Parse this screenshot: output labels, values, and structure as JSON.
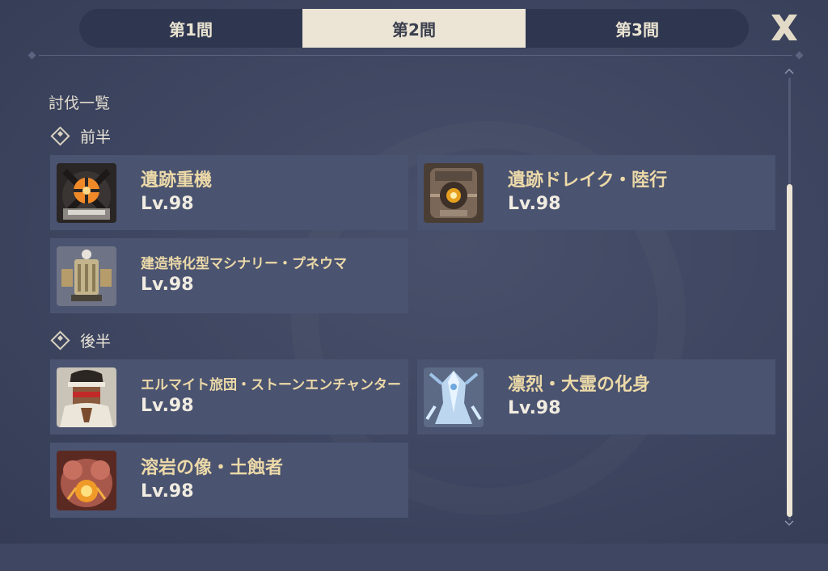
{
  "tabs": [
    {
      "label": "第1間",
      "active": false
    },
    {
      "label": "第2間",
      "active": true
    },
    {
      "label": "第3間",
      "active": false
    }
  ],
  "close_icon": "close-x-icon",
  "list_title": "討伐一覧",
  "sections": [
    {
      "label": "前半",
      "enemies": [
        {
          "name": "遺跡重機",
          "level": "Lv.98",
          "icon": "ruin-grader-icon"
        },
        {
          "name": "遺跡ドレイク・陸行",
          "level": "Lv.98",
          "icon": "ruin-drake-earthguard-icon"
        },
        {
          "name": "建造特化型マシナリー・プネウマ",
          "level": "Lv.98",
          "icon": "construction-machinery-icon"
        }
      ]
    },
    {
      "label": "後半",
      "enemies": [
        {
          "name": "エルマイト旅団・ストーンエンチャンター",
          "level": "Lv.98",
          "icon": "eremite-stone-enchanter-icon"
        },
        {
          "name": "凛烈・大霊の化身",
          "level": "Lv.98",
          "icon": "frost-spirit-avatar-icon"
        },
        {
          "name": "溶岩の像・土蝕者",
          "level": "Lv.98",
          "icon": "lava-statue-icon"
        }
      ]
    }
  ],
  "colors": {
    "background": "#3e4661",
    "card": "#4a5370",
    "tab_active": "#ece5d6",
    "enemy_name": "#ecd9a8"
  }
}
